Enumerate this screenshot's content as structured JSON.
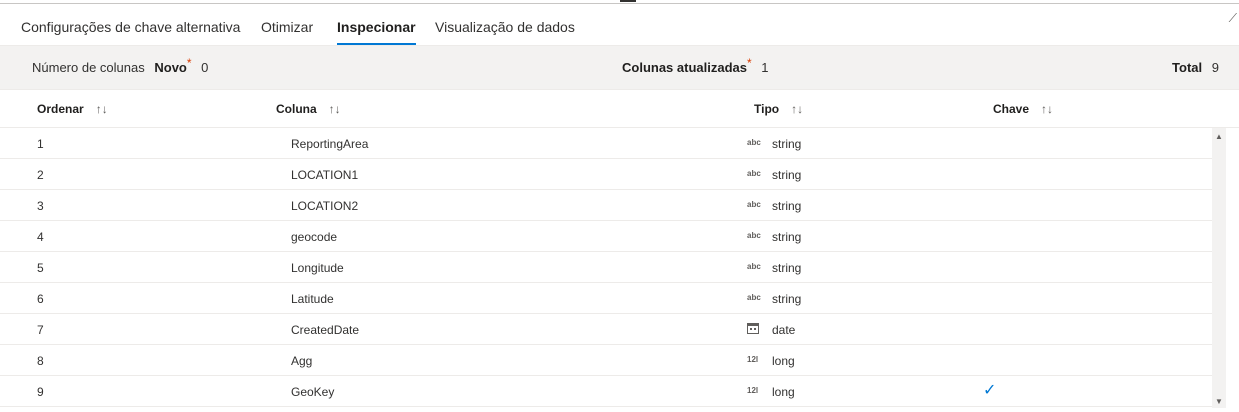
{
  "tabs": [
    {
      "label": "Configurações de chave alternativa",
      "active": false
    },
    {
      "label": "Otimizar",
      "active": false
    },
    {
      "label": "Inspecionar",
      "active": true
    },
    {
      "label": "Visualização de dados",
      "active": false
    }
  ],
  "summary": {
    "columns_label": "Número de colunas",
    "new_label": "Novo",
    "new_marker": "*",
    "new_value": "0",
    "updated_label": "Colunas atualizadas",
    "updated_marker": "*",
    "updated_value": "1",
    "total_label": "Total",
    "total_value": "9"
  },
  "table": {
    "headers": {
      "order": "Ordenar",
      "column": "Coluna",
      "type": "Tipo",
      "key": "Chave",
      "sort_icon": "↑↓"
    },
    "rows": [
      {
        "order": "1",
        "column": "ReportingArea",
        "type_icon": "abc",
        "type": "string",
        "key": false
      },
      {
        "order": "2",
        "column": "LOCATION1",
        "type_icon": "abc",
        "type": "string",
        "key": false
      },
      {
        "order": "3",
        "column": "LOCATION2",
        "type_icon": "abc",
        "type": "string",
        "key": false
      },
      {
        "order": "4",
        "column": "geocode",
        "type_icon": "abc",
        "type": "string",
        "key": false
      },
      {
        "order": "5",
        "column": "Longitude",
        "type_icon": "abc",
        "type": "string",
        "key": false
      },
      {
        "order": "6",
        "column": "Latitude",
        "type_icon": "abc",
        "type": "string",
        "key": false
      },
      {
        "order": "7",
        "column": "CreatedDate",
        "type_icon": "calendar-icon",
        "type": "date",
        "key": false
      },
      {
        "order": "8",
        "column": "Agg",
        "type_icon": "12l",
        "type": "long",
        "key": false
      },
      {
        "order": "9",
        "column": "GeoKey",
        "type_icon": "12l",
        "type": "long",
        "key": true,
        "key_glyph": "✓"
      }
    ]
  },
  "icons": {
    "collapse": "chevron-icon",
    "scroll_up": "▲",
    "scroll_down": "▼"
  },
  "colors": {
    "accent": "#0078d4",
    "marker": "#d83b01",
    "summary_bg": "#f3f2f1"
  }
}
